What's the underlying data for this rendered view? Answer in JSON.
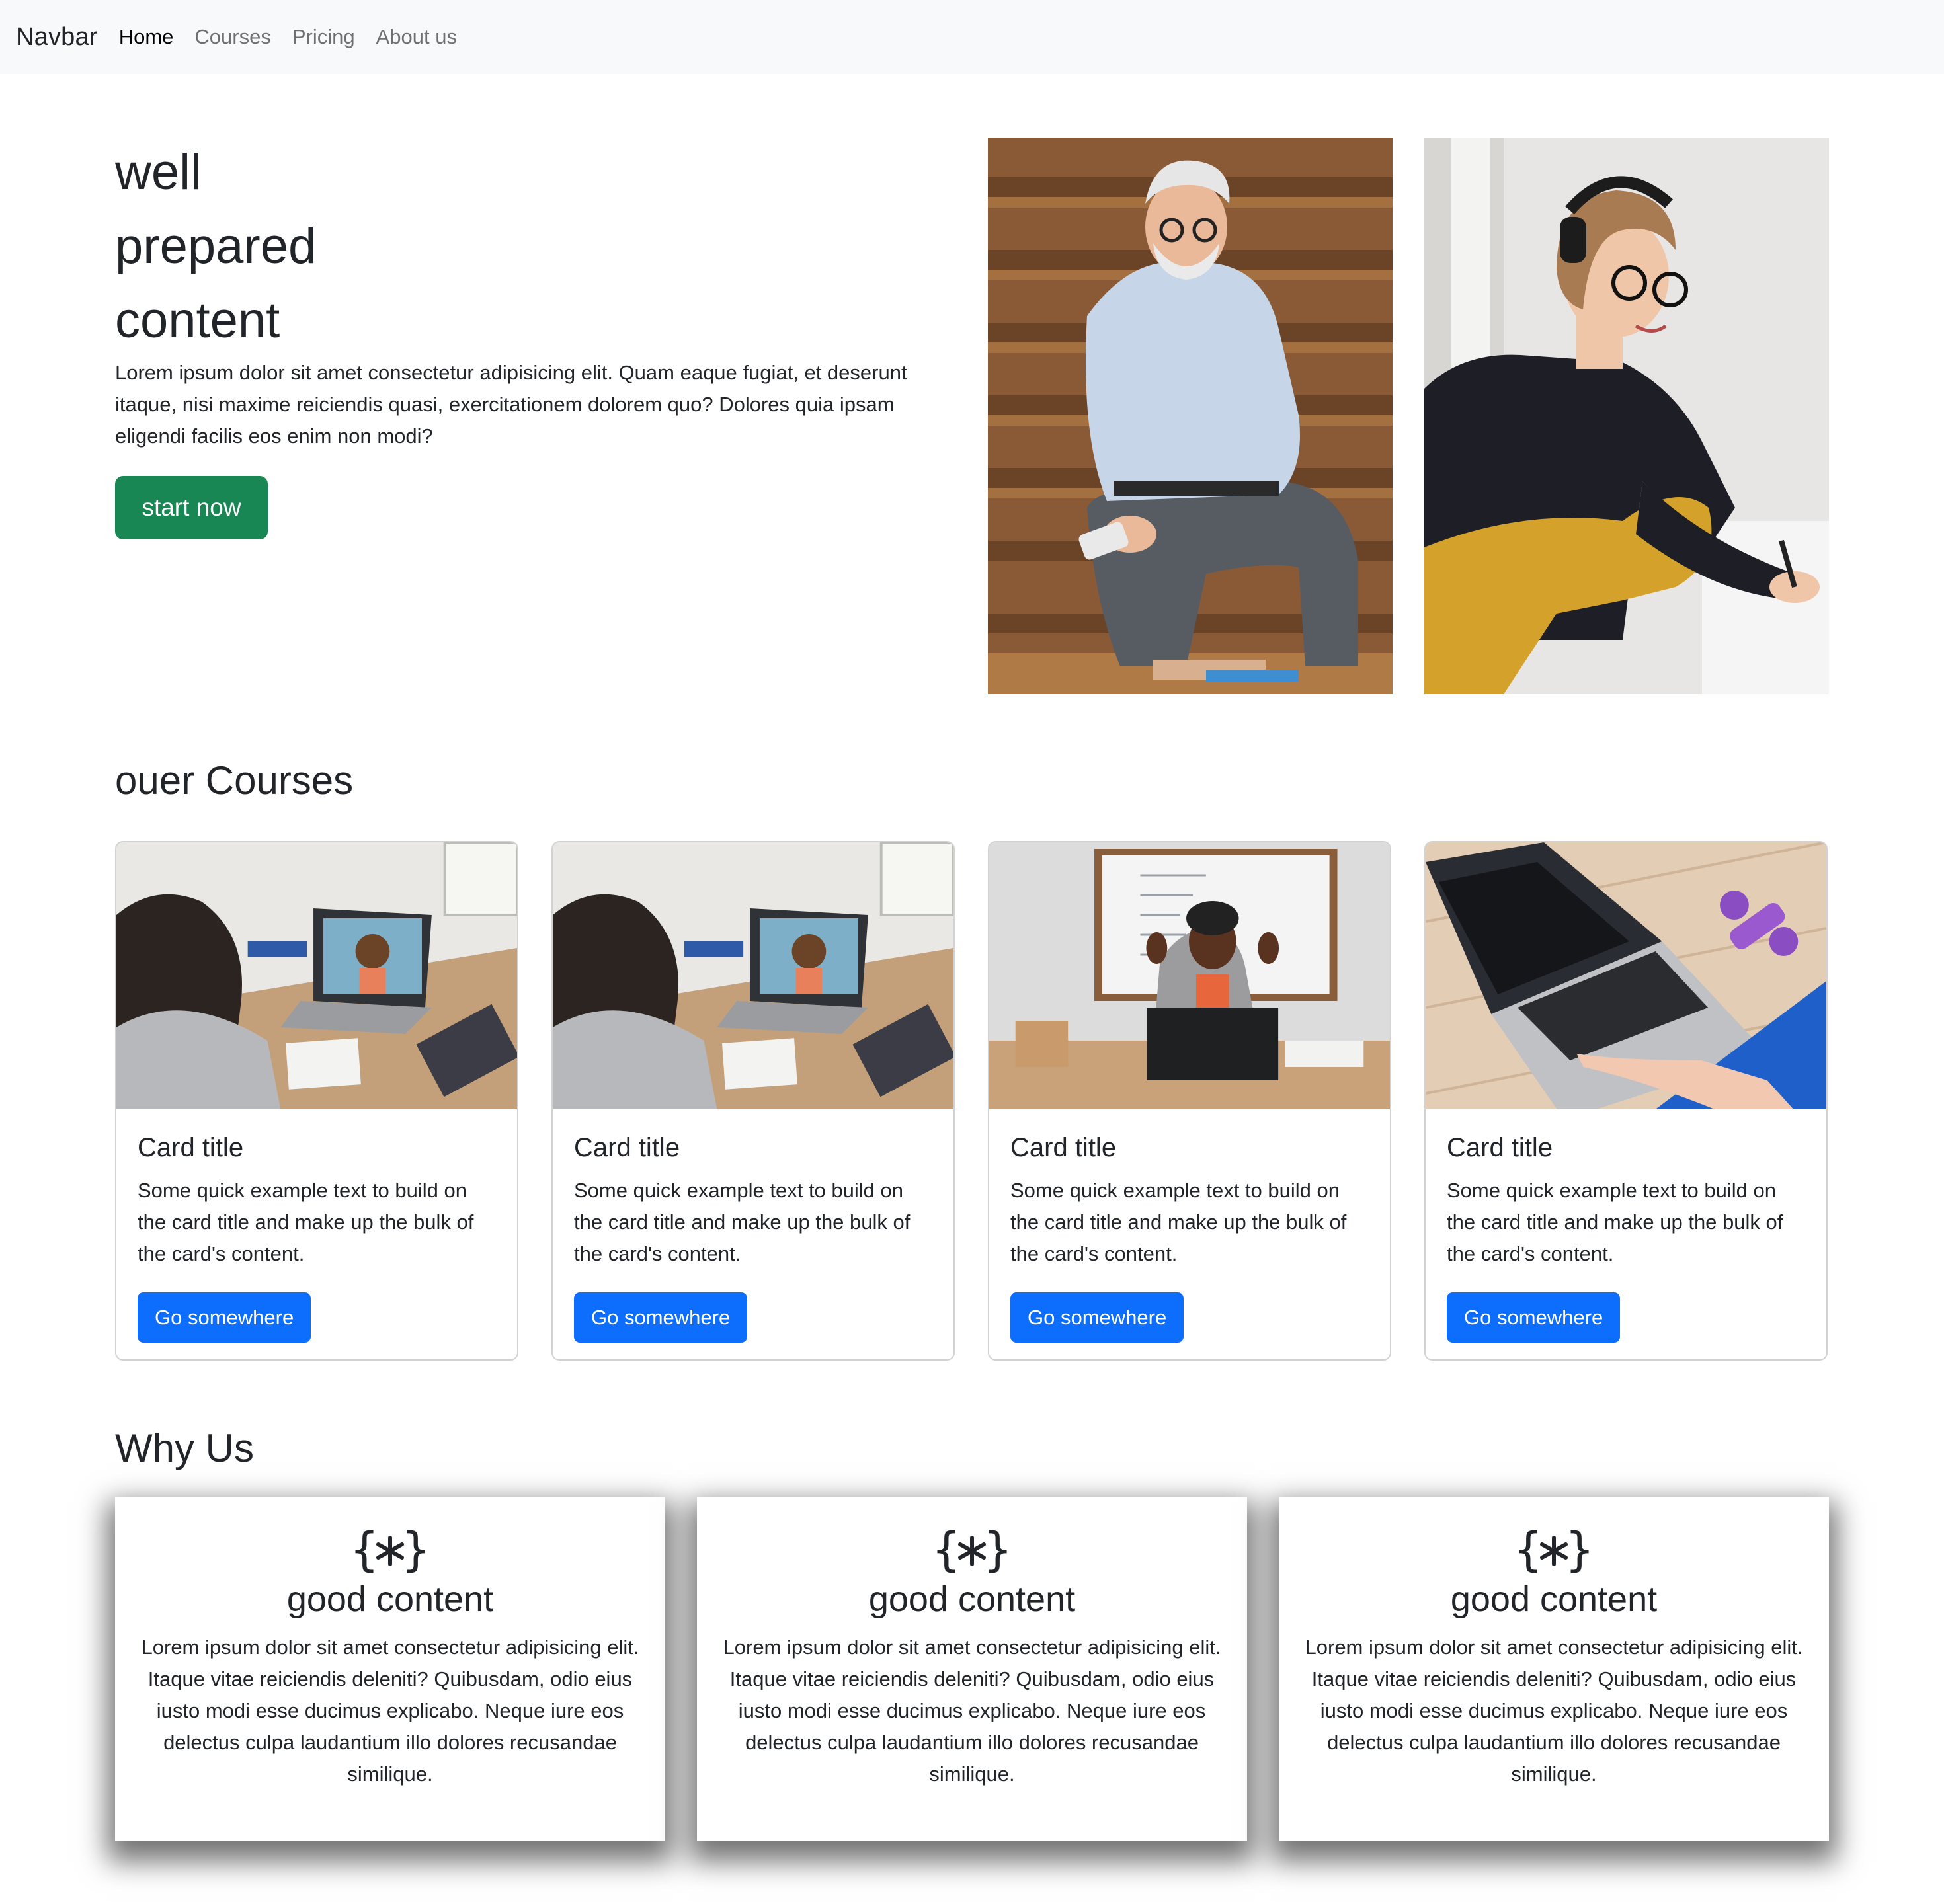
{
  "navbar": {
    "brand": "Navbar",
    "links": [
      "Home",
      "Courses",
      "Pricing",
      "About us"
    ],
    "active": "Home"
  },
  "hero": {
    "title_lines": [
      "well",
      "prepared",
      "content"
    ],
    "text": "Lorem ipsum dolor sit amet consectetur adipisicing elit. Quam eaque fugiat, et deserunt itaque, nisi maxime reiciendis quasi, exercitationem dolorem quo? Dolores quia ipsam eligendi facilis eos enim non modi?",
    "button": "start now"
  },
  "courses": {
    "title": "ouer Courses",
    "cards": [
      {
        "title": "Card title",
        "text": "Some quick example text to build on the card title and make up the bulk of the card's content.",
        "button": "Go somewhere"
      },
      {
        "title": "Card title",
        "text": "Some quick example text to build on the card title and make up the bulk of the card's content.",
        "button": "Go somewhere"
      },
      {
        "title": "Card title",
        "text": "Some quick example text to build on the card title and make up the bulk of the card's content.",
        "button": "Go somewhere"
      },
      {
        "title": "Card title",
        "text": "Some quick example text to build on the card title and make up the bulk of the card's content.",
        "button": "Go somewhere"
      }
    ]
  },
  "why": {
    "title": "Why Us",
    "cards": [
      {
        "icon": "code-braces-asterisk-icon",
        "heading": "good content",
        "text": "Lorem ipsum dolor sit amet consectetur adipisicing elit. Itaque vitae reiciendis deleniti? Quibusdam, odio eius iusto modi esse ducimus explicabo. Neque iure eos delectus culpa laudantium illo dolores recusandae similique."
      },
      {
        "icon": "code-braces-asterisk-icon",
        "heading": "good content",
        "text": "Lorem ipsum dolor sit amet consectetur adipisicing elit. Itaque vitae reiciendis deleniti? Quibusdam, odio eius iusto modi esse ducimus explicabo. Neque iure eos delectus culpa laudantium illo dolores recusandae similique."
      },
      {
        "icon": "code-braces-asterisk-icon",
        "heading": "good content",
        "text": "Lorem ipsum dolor sit amet consectetur adipisicing elit. Itaque vitae reiciendis deleniti? Quibusdam, odio eius iusto modi esse ducimus explicabo. Neque iure eos delectus culpa laudantium illo dolores recusandae similique."
      }
    ]
  },
  "colors": {
    "navbar_bg": "#f8f9fa",
    "start_button": "#198754",
    "card_button": "#0d6efd",
    "text": "#212529"
  }
}
